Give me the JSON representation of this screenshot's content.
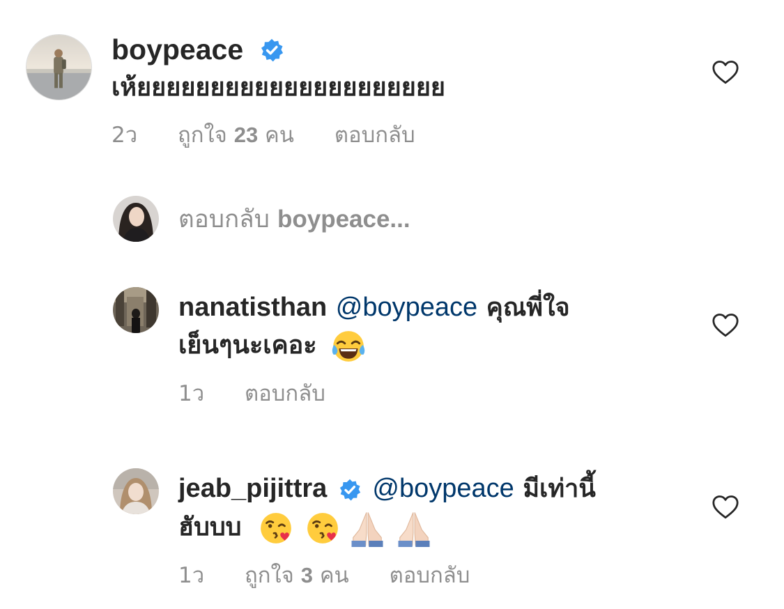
{
  "comments": [
    {
      "username": "boypeace",
      "verified": true,
      "text": "เห้ยยยยยยยยยยยยยยยยยยยยย",
      "time": "2ว",
      "likes_label": "ถูกใจ",
      "likes_count": "23",
      "likes_unit": "คน",
      "reply_label": "ตอบกลับ"
    },
    {
      "username": "nanatisthan",
      "verified": false,
      "mention": "@boypeace",
      "text_line1": "คุณพี่ใจ",
      "text_line2": "เย็นๆนะเคอะ",
      "time": "1ว",
      "reply_label": "ตอบกลับ"
    },
    {
      "username": "jeab_pijittra",
      "verified": true,
      "mention": "@boypeace",
      "text_line1": "มีเท่านี้",
      "text_line2": "ฮับบบ",
      "time": "1ว",
      "likes_label": "ถูกใจ",
      "likes_count": "3",
      "likes_unit": "คน",
      "reply_label": "ตอบกลับ"
    }
  ],
  "reply_prompt": {
    "label": "ตอบกลับ",
    "username": "boypeace..."
  },
  "colors": {
    "text": "#262626",
    "meta": "#8e8e8e",
    "mention": "#00376b",
    "verified": "#3897f0"
  },
  "icons": {
    "like": "heart-outline-icon",
    "verified": "verified-badge-icon",
    "emoji_laugh": "face-with-tears-of-joy-emoji",
    "emoji_kiss": "face-blowing-kiss-emoji",
    "emoji_pray": "folded-hands-emoji"
  }
}
